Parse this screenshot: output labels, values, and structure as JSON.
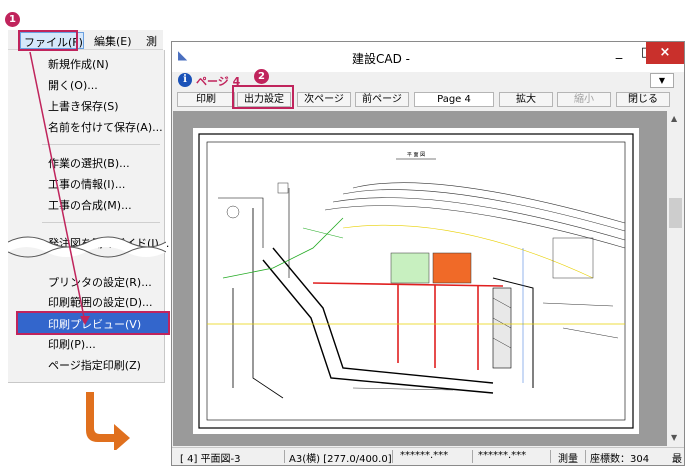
{
  "menubar": {
    "file": "ファイル(F)",
    "edit": "編集(E)",
    "survey": "測量"
  },
  "file_menu": {
    "items": [
      "新規作成(N)",
      "開く(O)...",
      "上書き保存(S)",
      "名前を付けて保存(A)...",
      "作業の選択(B)...",
      "工事の情報(I)...",
      "工事の合成(M)...",
      "発注図を開くガイド(J)...",
      "プリンタの設定(R)...",
      "印刷範囲の設定(D)...",
      "印刷プレビュー(V)",
      "印刷(P)...",
      "ページ指定印刷(Z)"
    ]
  },
  "markers": {
    "step1": "1",
    "step2": "2"
  },
  "window": {
    "title": "建設CAD -",
    "page_label": "ページ 4",
    "minimize": "_",
    "maximize": "□",
    "close": "×",
    "dropdown_glyph": "▼",
    "toolbar": {
      "print": "印刷",
      "output_settings": "出力設定",
      "next_page": "次ページ",
      "prev_page": "前ページ",
      "page_field": "Page 4",
      "zoom_in": "拡大",
      "zoom_out": "縮小",
      "close": "閉じる"
    },
    "drawing_title": "平 面 図",
    "status": {
      "layer": "[  4] 平面図-3",
      "paper": "A3(横) [277.0/400.0]",
      "coord_x": "******.***",
      "coord_y": "******.***",
      "mode": "測量",
      "points": "座標数：304",
      "extra": "最"
    }
  },
  "colors": {
    "accent": "#c0245c",
    "menu_highlight": "#3366cc",
    "arrow": "#e0701e",
    "close_button": "#c9302c"
  }
}
